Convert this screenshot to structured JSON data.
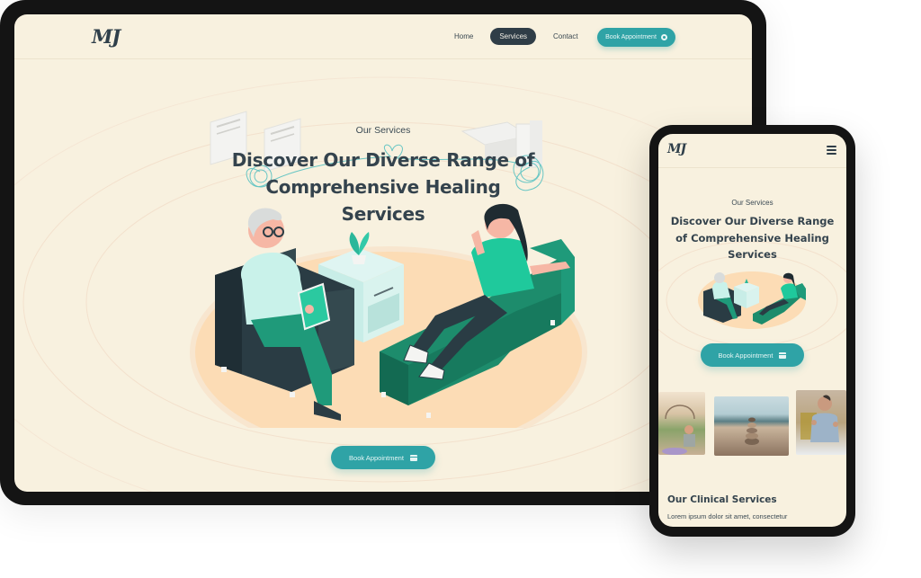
{
  "desktop": {
    "logo": "MJ",
    "nav": {
      "items": [
        {
          "label": "Home",
          "active": false
        },
        {
          "label": "Services",
          "active": true
        },
        {
          "label": "Contact",
          "active": false
        }
      ],
      "book_button": {
        "label": "Book Appointment",
        "icon": "plus-circle-icon"
      }
    },
    "hero": {
      "eyebrow": "Our Services",
      "title": "Discover Our Diverse Range of Comprehensive Healing Services",
      "illustration": "therapy-session-illustration",
      "cta": {
        "label": "Book Appointment",
        "icon": "calendar-icon"
      }
    }
  },
  "mobile": {
    "logo": "MJ",
    "menu_icon": "hamburger-menu-icon",
    "hero": {
      "eyebrow": "Our Services",
      "title": "Discover Our Diverse Range of Comprehensive Healing Services",
      "illustration": "therapy-session-illustration",
      "cta": {
        "label": "Book Appointment",
        "icon": "calendar-icon"
      }
    },
    "photos": [
      {
        "subject": "outdoor-yoga-meditation"
      },
      {
        "subject": "stacked-stones-on-beach"
      },
      {
        "subject": "therapist-speaking"
      }
    ],
    "section": {
      "title": "Our Clinical Services",
      "body": "Lorem ipsum dolor sit amet, consectetur"
    }
  },
  "colors": {
    "background": "#f8f1df",
    "accent": "#2fa3a6",
    "text": "#34434d",
    "dark": "#2f3d47",
    "device_frame": "#141414",
    "peach": "#fcdcb5",
    "green": "#1f9a7a"
  }
}
